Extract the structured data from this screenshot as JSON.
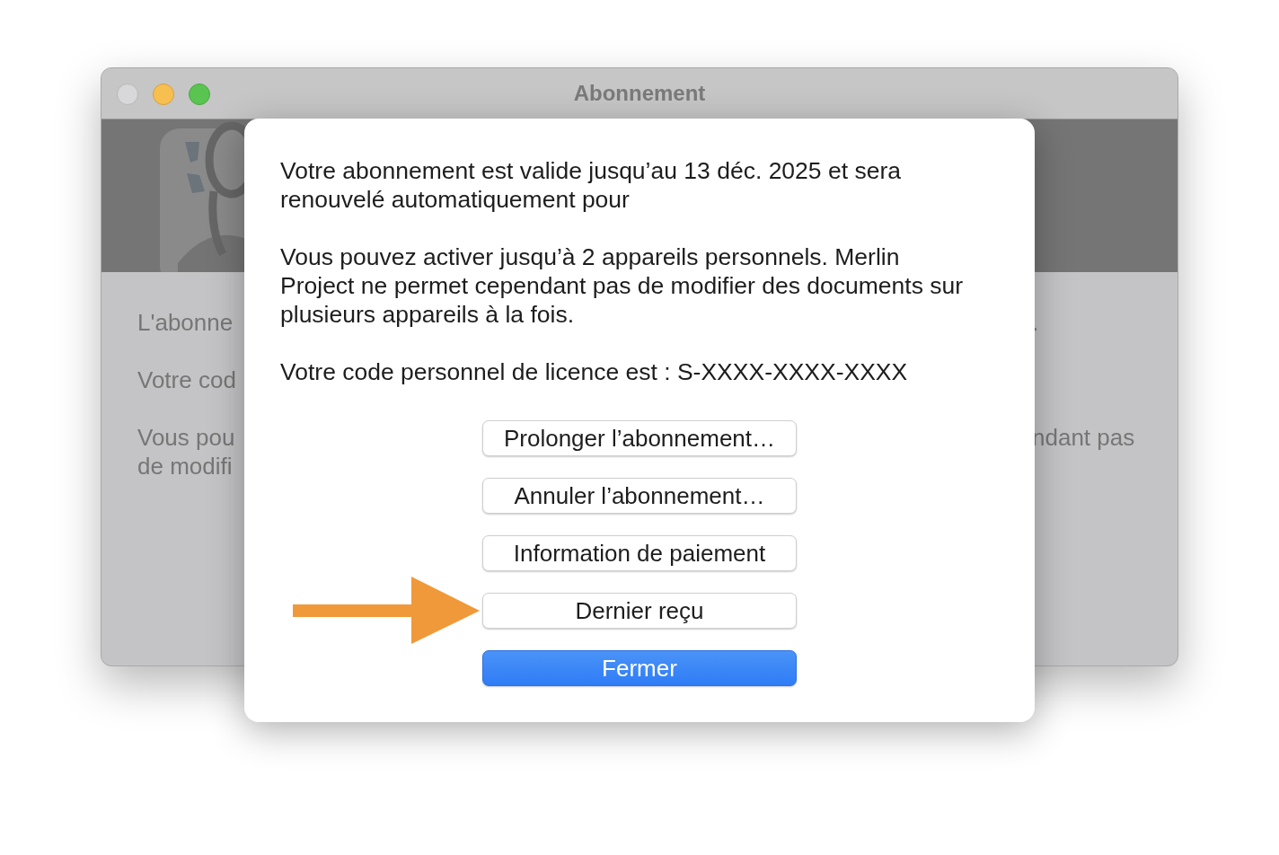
{
  "window": {
    "title": "Abonnement"
  },
  "background_text": [
    {
      "left": [
        "L'abonne"
      ],
      "right": [
        "."
      ]
    },
    {
      "left": [
        "Votre cod"
      ]
    },
    {
      "left": [
        "Vous pou",
        "de modifi"
      ],
      "right": [
        "ndant pas"
      ]
    }
  ],
  "dialog": {
    "paragraphs": [
      "Votre abonnement est valide jusqu’au 13 déc. 2025 et sera\nrenouvelé automatiquement pour",
      "Vous pouvez activer jusqu’à 2 appareils personnels. Merlin\nProject ne permet cependant pas de modifier des documents sur\nplusieurs appareils à la fois.",
      "Votre code personnel de licence est : S-XXXX-XXXX-XXXX"
    ],
    "buttons": [
      {
        "label": "Prolonger l’abonnement…",
        "default": false
      },
      {
        "label": "Annuler l’abonnement…",
        "default": false
      },
      {
        "label": "Information de paiement",
        "default": false
      },
      {
        "label": "Dernier reçu",
        "default": false
      },
      {
        "label": "Fermer",
        "default": true
      }
    ]
  }
}
